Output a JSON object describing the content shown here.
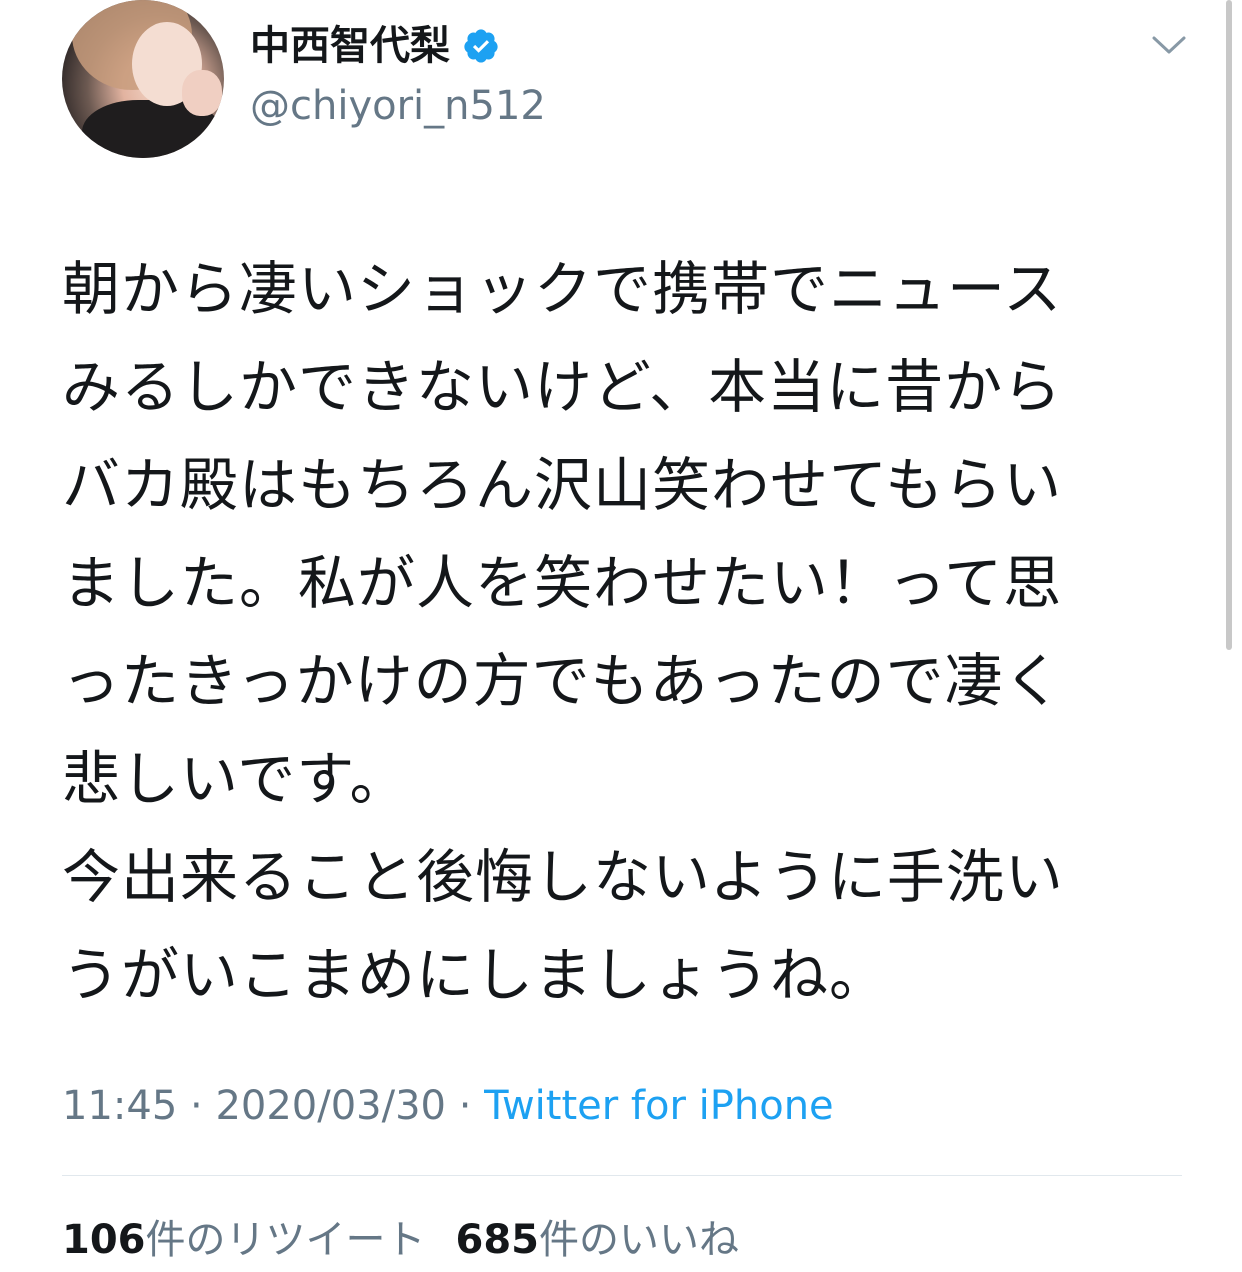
{
  "user": {
    "display_name": "中西智代梨",
    "handle": "@chiyori_n512",
    "verified_icon": "verified-badge-icon"
  },
  "tweet": {
    "lines": [
      "朝から凄いショックで携帯でニュース",
      "みるしかできないけど、本当に昔から",
      "バカ殿はもちろん沢山笑わせてもらい",
      "ました。私が人を笑わせたい！って思",
      "ったきっかけの方でもあったので凄く",
      "悲しいです。",
      "今出来ること後悔しないように手洗い",
      "うがいこまめにしましょうね。"
    ]
  },
  "meta": {
    "time": "11:45",
    "separator1": " · ",
    "date": "2020/03/30",
    "separator2": " · ",
    "source": "Twitter for iPhone"
  },
  "stats": {
    "retweets_count": "106",
    "retweets_label": "件のリツイート",
    "likes_count": "685",
    "likes_label": "件のいいね"
  },
  "colors": {
    "text": "#14171a",
    "secondary": "#657786",
    "link": "#1da1f2",
    "divider": "#e1e8ed"
  }
}
